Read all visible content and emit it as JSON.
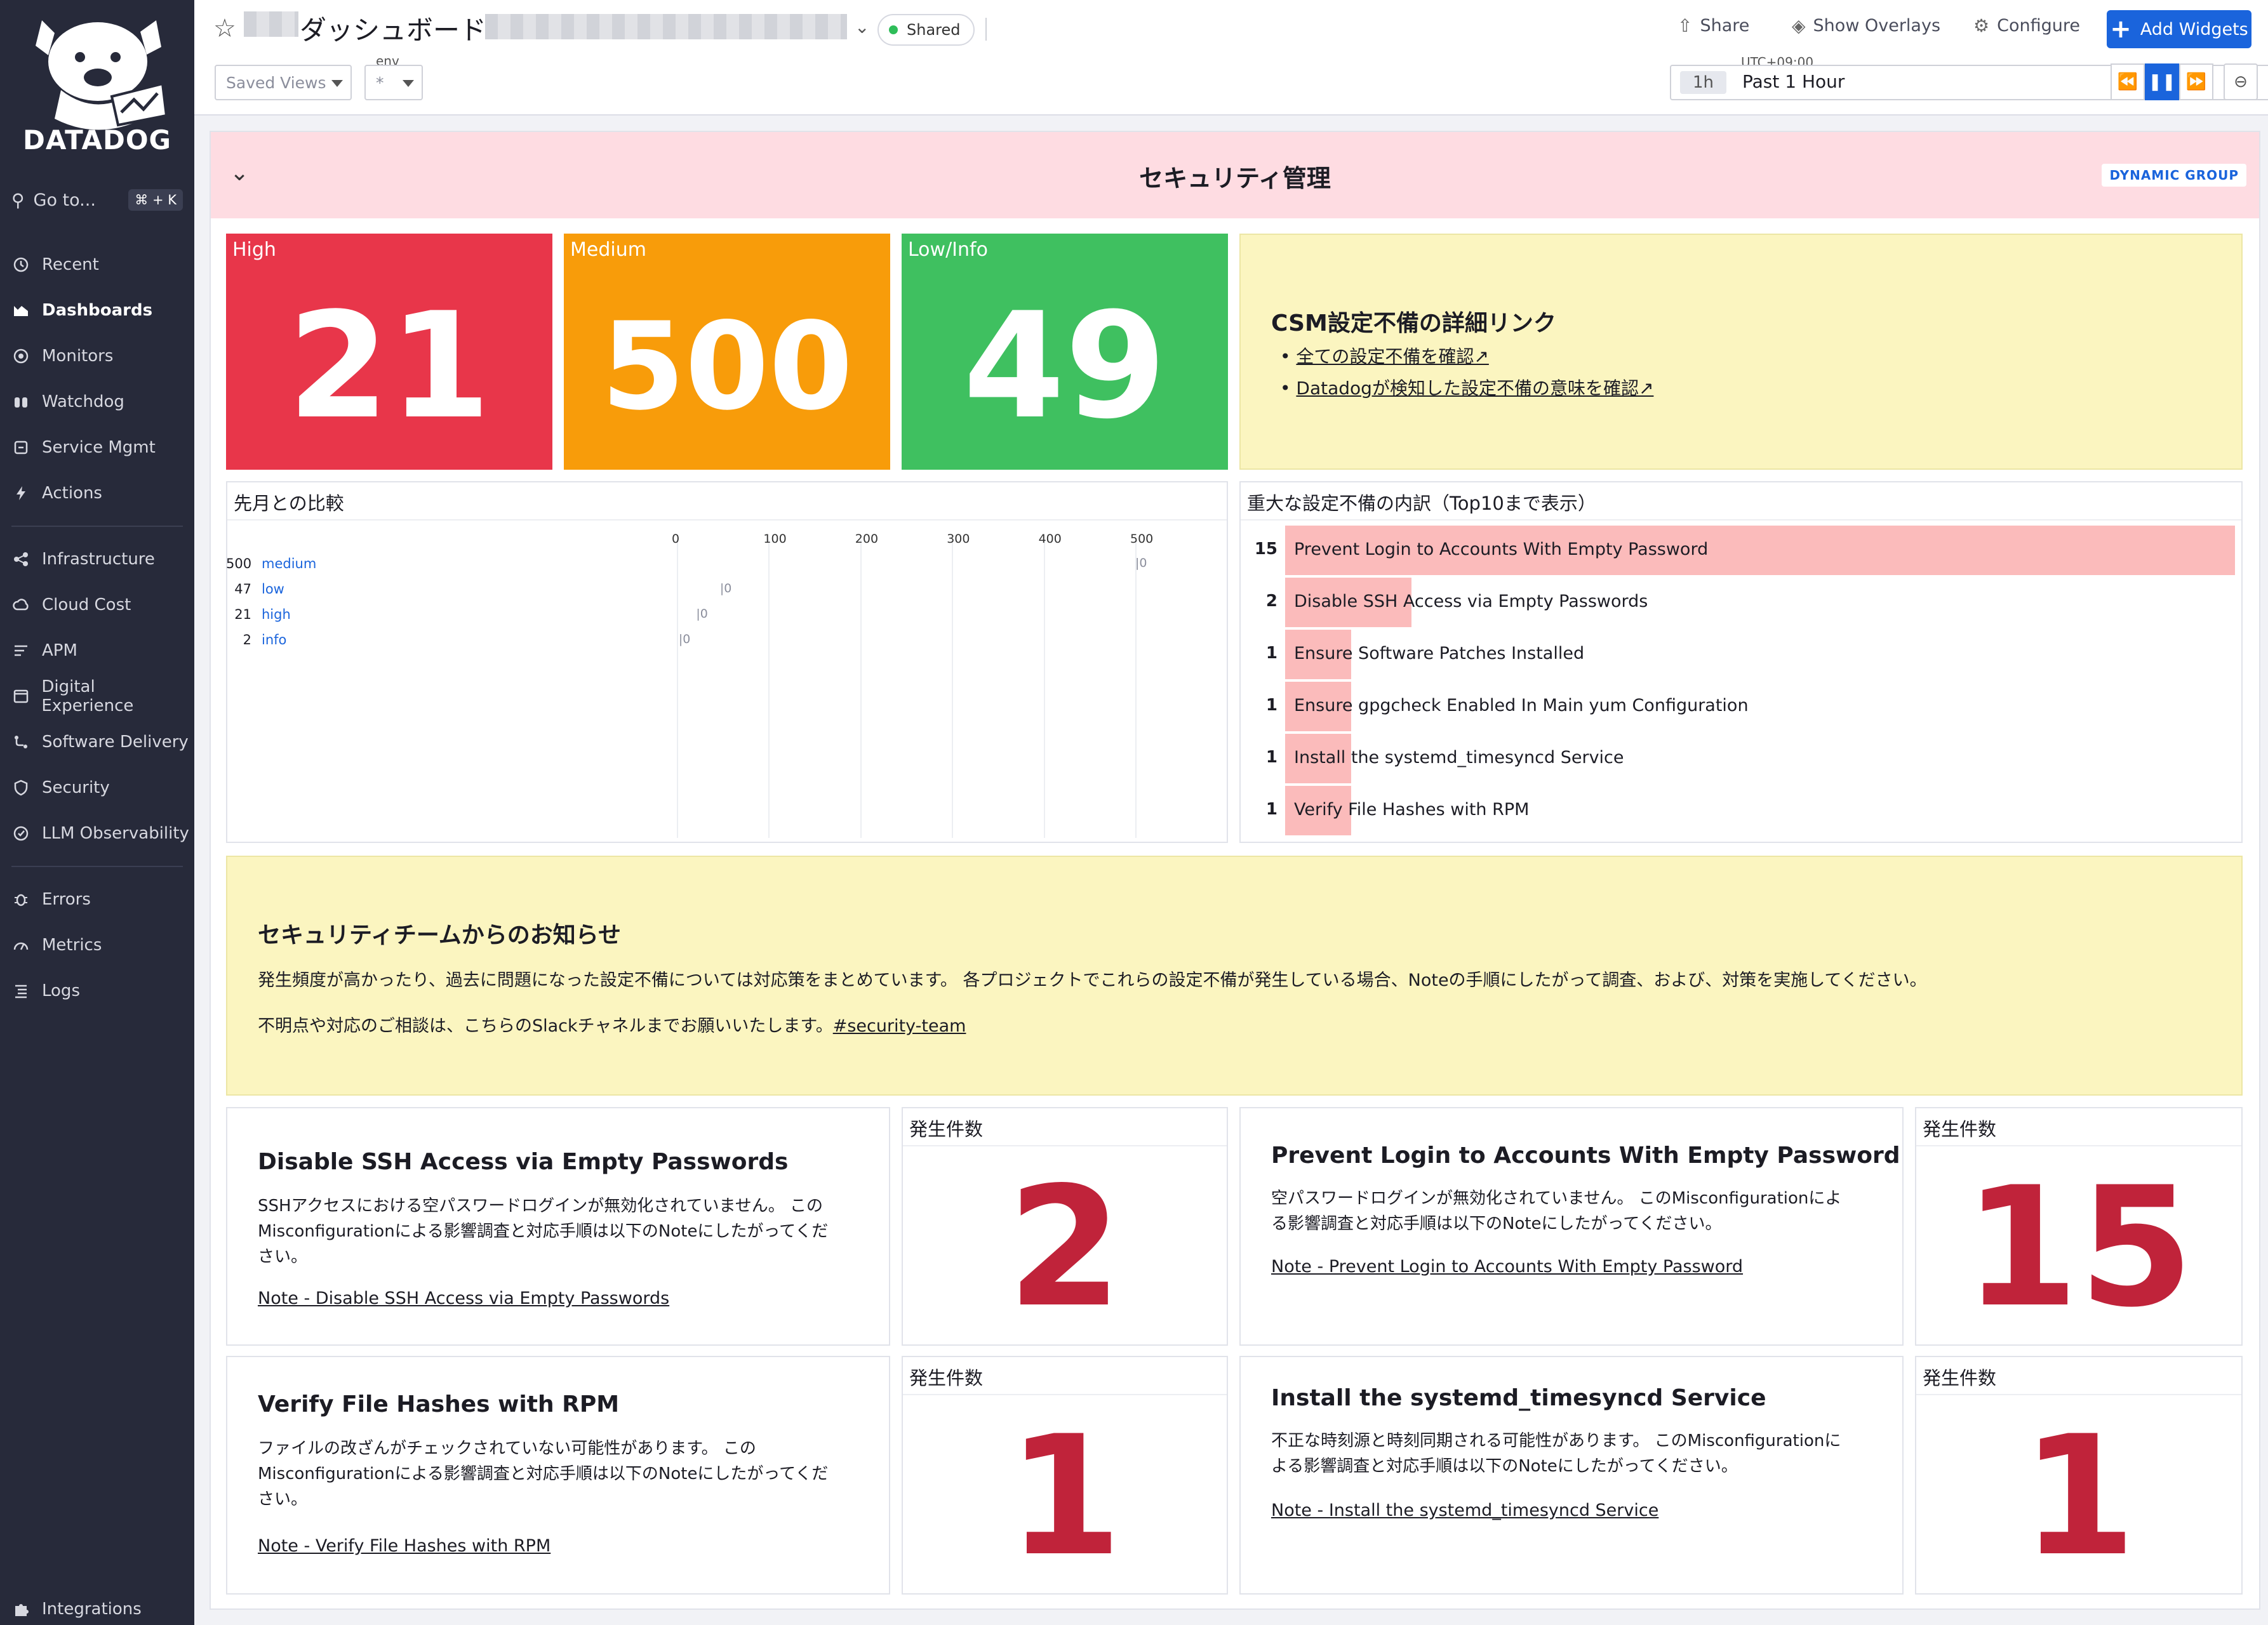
{
  "sidebar": {
    "brand": "DATADOG",
    "goto_label": "Go to...",
    "goto_shortcut": "⌘ + K",
    "items": [
      {
        "label": "Recent",
        "icon": "clock-icon"
      },
      {
        "label": "Dashboards",
        "icon": "dashboard-icon",
        "active": true
      },
      {
        "label": "Monitors",
        "icon": "monitor-icon"
      },
      {
        "label": "Watchdog",
        "icon": "binoculars-icon"
      },
      {
        "label": "Service Mgmt",
        "icon": "service-icon"
      },
      {
        "label": "Actions",
        "icon": "lightning-icon"
      },
      {
        "label": "Infrastructure",
        "icon": "infrastructure-icon"
      },
      {
        "label": "Cloud Cost",
        "icon": "cloud-icon"
      },
      {
        "label": "APM",
        "icon": "apm-icon"
      },
      {
        "label": "Digital Experience",
        "icon": "browser-icon"
      },
      {
        "label": "Software Delivery",
        "icon": "delivery-icon"
      },
      {
        "label": "Security",
        "icon": "shield-icon"
      },
      {
        "label": "LLM Observability",
        "icon": "llm-icon"
      },
      {
        "label": "Errors",
        "icon": "bug-icon"
      },
      {
        "label": "Metrics",
        "icon": "metrics-icon"
      },
      {
        "label": "Logs",
        "icon": "logs-icon"
      },
      {
        "label": "Integrations",
        "icon": "puzzle-icon"
      }
    ]
  },
  "header": {
    "title": "ダッシュボード",
    "shared_label": "Shared",
    "share_label": "Share",
    "overlays_label": "Show Overlays",
    "configure_label": "Configure",
    "add_widgets_label": "Add Widgets",
    "saved_views_placeholder": "Saved Views",
    "env_label": "env",
    "env_value": "*",
    "timezone": "UTC+09:00",
    "time_chip": "1h",
    "time_label": "Past 1 Hour"
  },
  "group": {
    "title": "セキュリティ管理",
    "badge": "DYNAMIC GROUP",
    "header_color": "#fedce2"
  },
  "query_values": [
    {
      "title": "High",
      "value": "21",
      "color": "#e8364a"
    },
    {
      "title": "Medium",
      "value": "500",
      "color": "#f89c0a"
    },
    {
      "title": "Low/Info",
      "value": "49",
      "color": "#3fc060"
    }
  ],
  "links_note": {
    "title": "CSM設定不備の詳細リンク",
    "links": [
      "全ての設定不備を確認↗",
      "Datadogが検知した設定不備の意味を確認↗"
    ]
  },
  "compare": {
    "title": "先月との比較",
    "ticks": [
      "0",
      "100",
      "200",
      "300",
      "400",
      "500"
    ],
    "rows": [
      {
        "count": "500",
        "name": "medium",
        "value": 500,
        "marker": "0"
      },
      {
        "count": "47",
        "name": "low",
        "value": 47,
        "marker": "0"
      },
      {
        "count": "21",
        "name": "high",
        "value": 21,
        "marker": "0"
      },
      {
        "count": "2",
        "name": "info",
        "value": 2,
        "marker": "0"
      }
    ]
  },
  "toplist": {
    "title": "重大な設定不備の内訳（Top10まで表示）",
    "rows": [
      {
        "count": "15",
        "value": 15,
        "label": "Prevent Login to Accounts With Empty Password"
      },
      {
        "count": "2",
        "value": 2,
        "label": "Disable SSH Access via Empty Passwords"
      },
      {
        "count": "1",
        "value": 1,
        "label": "Ensure Software Patches Installed"
      },
      {
        "count": "1",
        "value": 1,
        "label": "Ensure gpgcheck Enabled In Main yum Configuration"
      },
      {
        "count": "1",
        "value": 1,
        "label": "Install the systemd_timesyncd Service"
      },
      {
        "count": "1",
        "value": 1,
        "label": "Verify File Hashes with RPM"
      }
    ]
  },
  "notice": {
    "title": "セキュリティチームからのお知らせ",
    "body": "発生頻度が高かったり、過去に問題になった設定不備については対応策をまとめています。 各プロジェクトでこれらの設定不備が発生している場合、Noteの手順にしたがって調査、および、対策を実施してください。",
    "contact_prefix": "不明点や対応のご相談は、こちらのSlackチャネルまでお願いいたします。",
    "contact_link": "#security-team"
  },
  "cards": [
    {
      "title": "Disable SSH Access via Empty Passwords",
      "body": "SSHアクセスにおける空パスワードログインが無効化されていません。 このMisconfigurationによる影響調査と対応手順は以下のNoteにしたがってください。",
      "link": "Note - Disable SSH Access via Empty Passwords",
      "count_title": "発生件数",
      "count": "2"
    },
    {
      "title": "Prevent Login to Accounts With Empty Password",
      "body": "空パスワードログインが無効化されていません。 このMisconfigurationによる影響調査と対応手順は以下のNoteにしたがってください。",
      "link": "Note - Prevent Login to Accounts With Empty Password",
      "count_title": "発生件数",
      "count": "15"
    },
    {
      "title": "Verify File Hashes with RPM",
      "body": "ファイルの改ざんがチェックされていない可能性があります。 このMisconfigurationによる影響調査と対応手順は以下のNoteにしたがってください。",
      "link": "Note - Verify File Hashes with RPM",
      "count_title": "発生件数",
      "count": "1"
    },
    {
      "title": "Install the systemd_timesyncd Service",
      "body": "不正な時刻源と時刻同期される可能性があります。 このMisconfigurationによる影響調査と対応手順は以下のNoteにしたがってください。",
      "link": "Note - Install the systemd_timesyncd Service",
      "count_title": "発生件数",
      "count": "1"
    }
  ]
}
